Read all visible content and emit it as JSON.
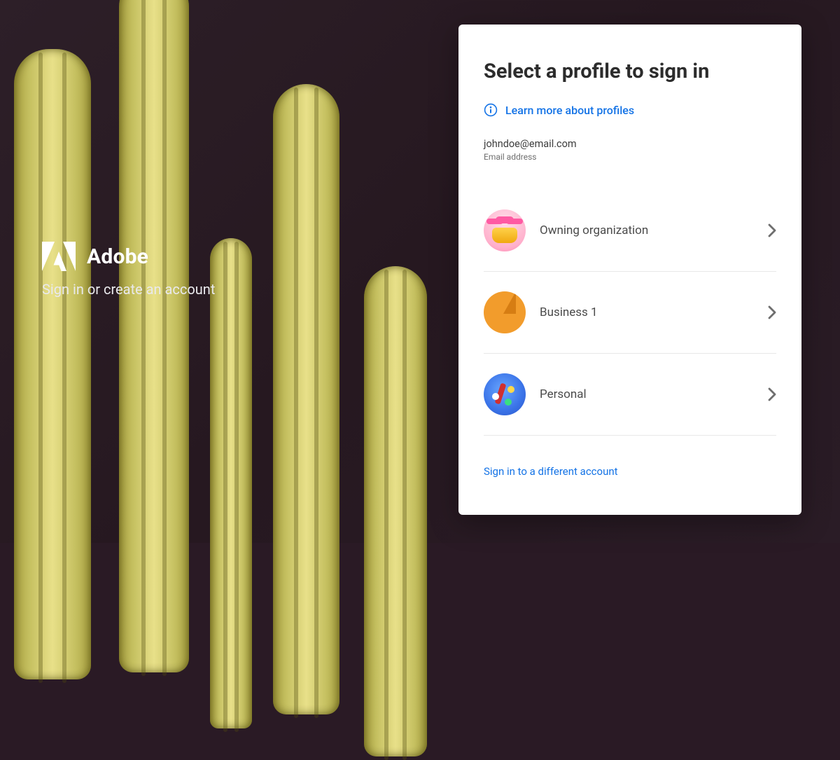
{
  "brand": {
    "name": "Adobe",
    "subtitle": "Sign in or create an account"
  },
  "panel": {
    "title": "Select a profile to sign in",
    "learn_more": "Learn more about profiles",
    "email": "johndoe@email.com",
    "email_label": "Email address",
    "profiles": [
      {
        "label": "Owning organization"
      },
      {
        "label": "Business 1"
      },
      {
        "label": "Personal"
      }
    ],
    "different_account": "Sign in to a different account"
  },
  "colors": {
    "link": "#1473e6"
  }
}
